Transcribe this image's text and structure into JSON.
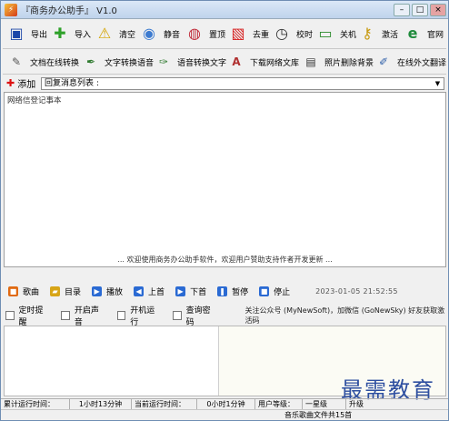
{
  "window": {
    "title": "『商务办公助手』 V1.0",
    "controls": {
      "min": "–",
      "max": "□",
      "close": "×"
    }
  },
  "toolbar1": [
    {
      "name": "export",
      "label": "导出",
      "icon": "floppy-disk-icon",
      "glyph": "▣",
      "color": "#1c47a8"
    },
    {
      "name": "import",
      "label": "导入",
      "icon": "green-cross-icon",
      "glyph": "✚",
      "color": "#2fa12a"
    },
    {
      "name": "clear",
      "label": "清空",
      "icon": "warning-icon",
      "glyph": "⚠",
      "color": "#d4a400"
    },
    {
      "name": "mute",
      "label": "静音",
      "icon": "cd-icon",
      "glyph": "◉",
      "color": "#3d7bd0"
    },
    {
      "name": "topmost",
      "label": "置顶",
      "icon": "globe-icon",
      "glyph": "◍",
      "color": "#c02c3a"
    },
    {
      "name": "remove-dup",
      "label": "去重",
      "icon": "red-squares-icon",
      "glyph": "▧",
      "color": "#d62020"
    },
    {
      "name": "sync-time",
      "label": "校时",
      "icon": "clock-icon",
      "glyph": "◷",
      "color": "#333333"
    },
    {
      "name": "shutdown",
      "label": "关机",
      "icon": "monitor-icon",
      "glyph": "▭",
      "color": "#2a8a2a"
    },
    {
      "name": "activate",
      "label": "激活",
      "icon": "key-icon",
      "glyph": "⚷",
      "color": "#c79a10"
    },
    {
      "name": "website",
      "label": "官网",
      "icon": "ie-globe-icon",
      "glyph": "e",
      "color": "#1f8b3c"
    }
  ],
  "toolbar2": [
    {
      "name": "doc-convert",
      "label": "文档在线转换",
      "icon": "pen-paper-icon",
      "glyph": "✎",
      "color": "#555555"
    },
    {
      "name": "text-to-speech",
      "label": "文字转换语音",
      "icon": "speech-pen-icon",
      "glyph": "✒",
      "color": "#2f7a2f"
    },
    {
      "name": "speech-to-text",
      "label": "语音转换文字",
      "icon": "voice-pen-icon",
      "glyph": "✑",
      "color": "#2f7a2f"
    },
    {
      "name": "download-lib",
      "label": "下载网络文库",
      "icon": "document-az-icon",
      "glyph": "A",
      "color": "#b03030"
    },
    {
      "name": "photo-bg",
      "label": "照片删除背景",
      "icon": "film-icon",
      "glyph": "▤",
      "color": "#333333"
    },
    {
      "name": "translate",
      "label": "在线外文翻译",
      "icon": "compass-pen-icon",
      "glyph": "✐",
      "color": "#2f5fa8"
    }
  ],
  "add_bar": {
    "add_label": "添加",
    "combo_value": "回复消息列表 :"
  },
  "memo": {
    "text": "网络信登记事本",
    "marquee": "... 欢迎使用商务办公助手软件，欢迎用户赞助支持作者开发更新 ..."
  },
  "player": {
    "buttons": [
      {
        "name": "song",
        "label": "歌曲",
        "glyph": "■",
        "color": "#e06a12"
      },
      {
        "name": "playlist",
        "label": "目录",
        "glyph": "▰",
        "color": "#d7a517"
      },
      {
        "name": "play",
        "label": "播放",
        "glyph": "▶",
        "color": "#2a6ad3"
      },
      {
        "name": "prev",
        "label": "上首",
        "glyph": "◀",
        "color": "#2a6ad3"
      },
      {
        "name": "next",
        "label": "下首",
        "glyph": "▶",
        "color": "#2a6ad3"
      },
      {
        "name": "pause",
        "label": "暂停",
        "glyph": "❚",
        "color": "#2a6ad3"
      },
      {
        "name": "stop",
        "label": "停止",
        "glyph": "■",
        "color": "#2a6ad3"
      }
    ],
    "datetime": "2023-01-05  21:52:55"
  },
  "options": {
    "items": [
      {
        "name": "timer-reminder",
        "label": "定时提醒"
      },
      {
        "name": "enable-sound",
        "label": "开启声音"
      },
      {
        "name": "auto-start",
        "label": "开机运行"
      },
      {
        "name": "query-password",
        "label": "查询密码"
      }
    ],
    "notice": "关注公众号 (MyNewSoft)，加微信 (GoNewSky) 好友获取激活码"
  },
  "watermark": "最需教育",
  "statusbar": {
    "total_label": "累计运行时间：",
    "total_value": "1小时13分钟",
    "current_label": "当前运行时间：",
    "current_value": "0小时1分钟",
    "level_label": "用户等级：",
    "level_value": "一星级",
    "upgrade_label": "升级"
  },
  "statusbar2": {
    "music_info": "音乐歌曲文件共15首"
  }
}
